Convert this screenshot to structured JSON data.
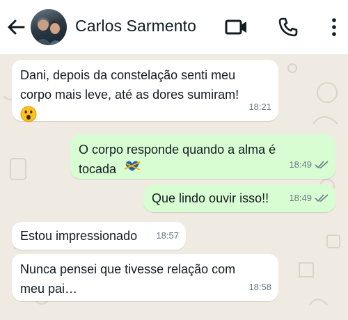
{
  "header": {
    "contact_name": "Carlos Sarmento"
  },
  "icons": {
    "back": "arrow-back-icon",
    "video": "video-call-icon",
    "voice": "phone-call-icon",
    "menu": "more-vertical-icon",
    "read": "double-check-icon"
  },
  "colors": {
    "header_bg": "#ffffff",
    "chat_bg": "#efeae2",
    "incoming_bubble": "#ffffff",
    "outgoing_bubble": "#d9fdd3",
    "timestamp": "#667781"
  },
  "messages": [
    {
      "direction": "incoming",
      "text": "Dani, depois da constelação senti meu\ncorpo mais leve, até as dores sumiram!",
      "emoji": "astonished-face-emoji",
      "time": "18:21"
    },
    {
      "direction": "outgoing",
      "text": "O corpo responde quando a alma é\ntocada",
      "emoji": "heart-arrows-emoji",
      "time": "18:49",
      "status": "read"
    },
    {
      "direction": "outgoing",
      "text": "Que lindo ouvir isso!!",
      "time": "18:49",
      "status": "read"
    },
    {
      "direction": "incoming",
      "text": "Estou impressionado",
      "time": "18:57"
    },
    {
      "direction": "incoming",
      "text": "Nunca pensei que tivesse relação com\nmeu pai…",
      "time": "18:58"
    }
  ]
}
